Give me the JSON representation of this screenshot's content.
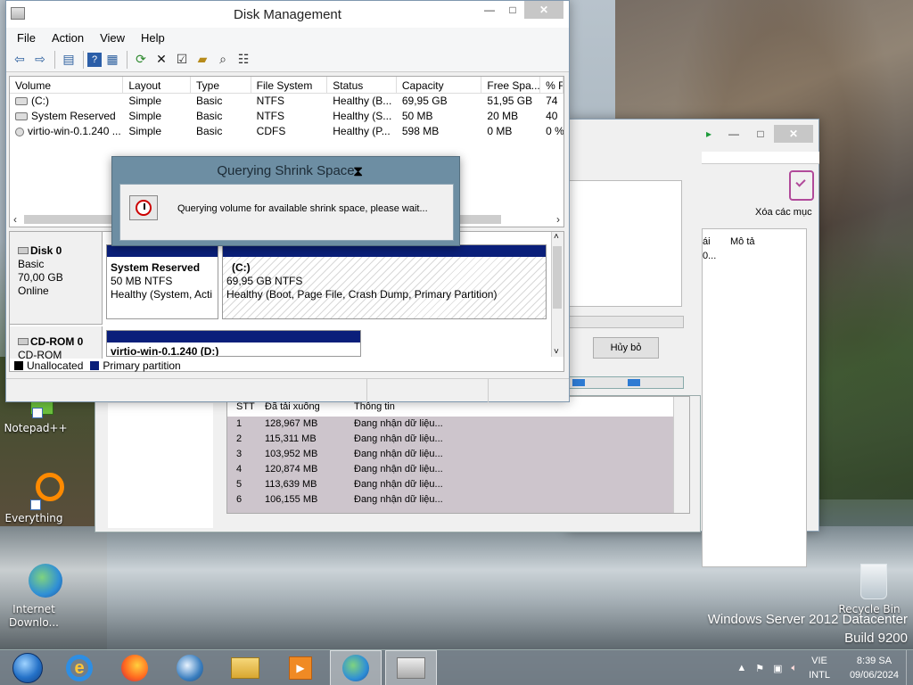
{
  "desktop": {
    "server_line1": "Windows Server 2012 Datacenter",
    "server_line2": "Build 9200",
    "icons": [
      {
        "label": "Notepad++"
      },
      {
        "label": "Everything"
      },
      {
        "label": "Internet Downlo..."
      },
      {
        "label": "Recycle Bin"
      }
    ]
  },
  "disk_mgmt": {
    "title": "Disk Management",
    "menu": [
      "File",
      "Action",
      "View",
      "Help"
    ],
    "columns": [
      "Volume",
      "Layout",
      "Type",
      "File System",
      "Status",
      "Capacity",
      "Free Spa...",
      "% F"
    ],
    "volumes": [
      [
        "(C:)",
        "Simple",
        "Basic",
        "NTFS",
        "Healthy (B...",
        "69,95 GB",
        "51,95 GB",
        "74"
      ],
      [
        "System Reserved",
        "Simple",
        "Basic",
        "NTFS",
        "Healthy (S...",
        "50 MB",
        "20 MB",
        "40"
      ],
      [
        "virtio-win-0.1.240 ...",
        "Simple",
        "Basic",
        "CDFS",
        "Healthy (P...",
        "598 MB",
        "0 MB",
        "0 %"
      ]
    ],
    "disks": {
      "disk0": {
        "name": "Disk 0",
        "type": "Basic",
        "size": "70,00 GB",
        "state": "Online"
      },
      "cdrom0": {
        "name": "CD-ROM 0",
        "type": "CD-ROM"
      }
    },
    "partitions": {
      "sysres": {
        "name": "System Reserved",
        "size": "50 MB NTFS",
        "status": "Healthy (System, Acti"
      },
      "c": {
        "name": "(C:)",
        "size": "69,95 GB NTFS",
        "status": "Healthy (Boot, Page File, Crash Dump, Primary Partition)"
      },
      "d": {
        "name": "virtio-win-0.1.240  (D:)"
      }
    },
    "legend": {
      "unallocated": "Unallocated",
      "primary": "Primary partition"
    },
    "colors": {
      "primary": "#0a1f7a",
      "unallocated": "#000000"
    }
  },
  "dialog": {
    "title": "Querying Shrink Space",
    "message": "Querying volume for available shrink space, please wait..."
  },
  "idm": {
    "delete_label": "Xóa các mục",
    "col_short": "ái",
    "col_desc": "Mô tả",
    "row_val": "0...",
    "cancel": "Hủy bỏ",
    "headers": [
      "STT",
      "Đã tải xuống",
      "Thông tin"
    ],
    "rows": [
      [
        "1",
        "128,967  MB",
        "Đang nhận dữ liệu..."
      ],
      [
        "2",
        "115,311  MB",
        "Đang nhận dữ liệu..."
      ],
      [
        "3",
        "103,952  MB",
        "Đang nhận dữ liệu..."
      ],
      [
        "4",
        "120,874  MB",
        "Đang nhận dữ liệu..."
      ],
      [
        "5",
        "113,639  MB",
        "Đang nhận dữ liệu..."
      ],
      [
        "6",
        "106,155  MB",
        "Đang nhận dữ liệu..."
      ]
    ]
  },
  "taskbar": {
    "lang1": "VIE",
    "lang2": "INTL",
    "time": "8:39 SA",
    "date": "09/06/2024"
  }
}
